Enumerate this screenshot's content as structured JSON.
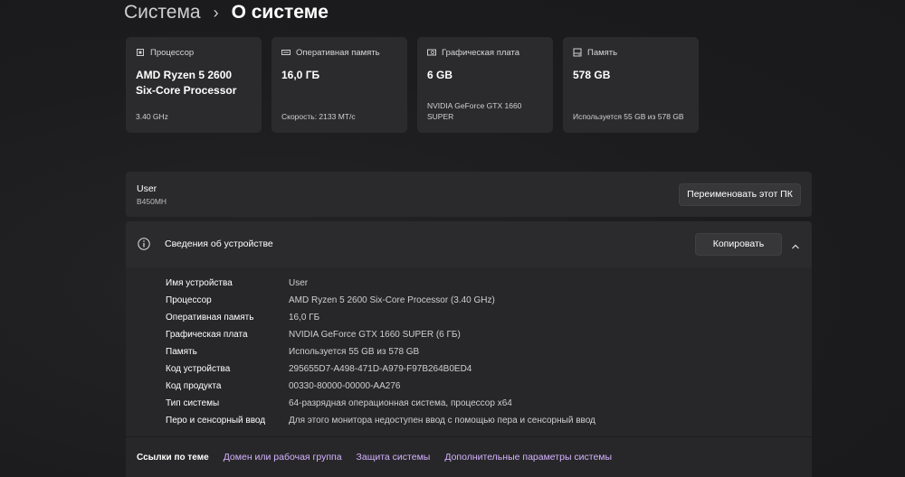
{
  "breadcrumb": {
    "parent": "Система",
    "separator": "›",
    "current": "О системе"
  },
  "cards": [
    {
      "icon": "cpu-icon",
      "label": "Процессор",
      "value": "AMD Ryzen 5 2600 Six-Core Processor",
      "detail": "3.40 GHz"
    },
    {
      "icon": "memory-icon",
      "label": "Оперативная память",
      "value": "16,0 ГБ",
      "detail": "Скорость: 2133 МТ/с"
    },
    {
      "icon": "gpu-icon",
      "label": "Графическая плата",
      "value": "6 GB",
      "detail": "NVIDIA GeForce GTX 1660 SUPER"
    },
    {
      "icon": "storage-icon",
      "label": "Память",
      "value": "578 GB",
      "detail": "Используется 55 GB из 578 GB"
    }
  ],
  "device": {
    "name": "User",
    "model": "B450MH",
    "rename_label": "Переименовать этот ПК"
  },
  "specs": {
    "title": "Сведения об устройстве",
    "copy_label": "Копировать",
    "rows": [
      {
        "label": "Имя устройства",
        "value": "User"
      },
      {
        "label": "Процессор",
        "value": "AMD Ryzen 5 2600 Six-Core Processor (3.40 GHz)"
      },
      {
        "label": "Оперативная память",
        "value": "16,0 ГБ"
      },
      {
        "label": "Графическая плата",
        "value": "NVIDIA GeForce GTX 1660 SUPER (6 ГБ)"
      },
      {
        "label": "Память",
        "value": "Используется 55 GB из 578 GB"
      },
      {
        "label": "Код устройства",
        "value": "295655D7-A498-471D-A979-F97B264B0ED4"
      },
      {
        "label": "Код продукта",
        "value": "00330-80000-00000-AA276"
      },
      {
        "label": "Тип системы",
        "value": "64-разрядная операционная система, процессор x64"
      },
      {
        "label": "Перо и сенсорный ввод",
        "value": "Для этого монитора недоступен ввод с помощью пера и сенсорный ввод"
      }
    ]
  },
  "related_links": {
    "label": "Ссылки по теме",
    "links": [
      "Домен или рабочая группа",
      "Защита системы",
      "Дополнительные параметры системы"
    ]
  },
  "colors": {
    "accent_link": "#d6b3ff",
    "card_bg": "#2b2b2d",
    "page_bg": "#1c1c1e"
  }
}
